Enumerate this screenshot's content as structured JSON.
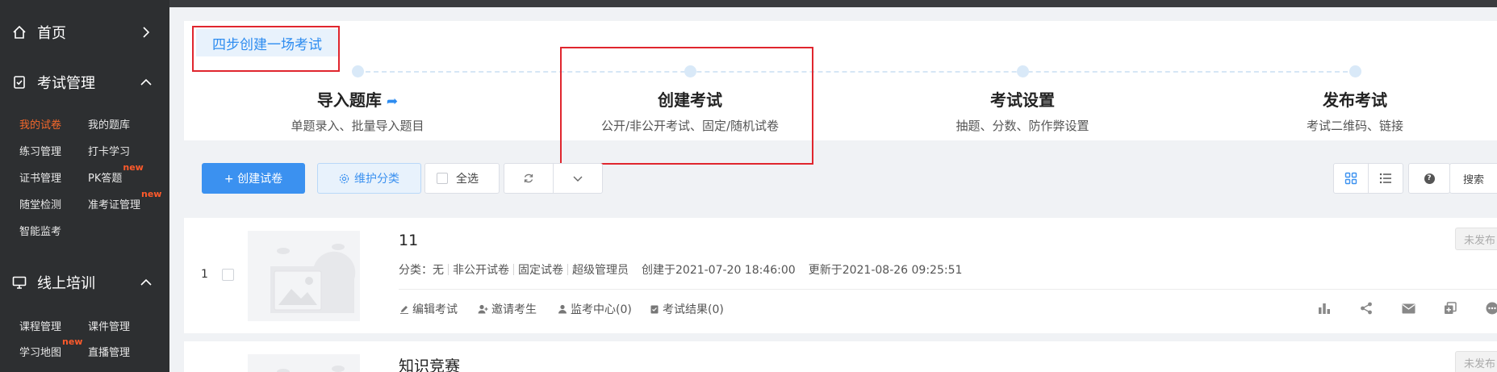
{
  "sidebar": {
    "sections": [
      {
        "label": "首页",
        "icon": "home-icon"
      },
      {
        "label": "考试管理",
        "icon": "exam-icon"
      },
      {
        "label": "线上培训",
        "icon": "monitor-icon"
      }
    ],
    "exam_items": [
      {
        "label": "我的试卷",
        "active": true
      },
      {
        "label": "我的题库"
      },
      {
        "label": "练习管理"
      },
      {
        "label": "打卡学习"
      },
      {
        "label": "证书管理"
      },
      {
        "label": "PK答题",
        "badge": "new"
      },
      {
        "label": "随堂检测"
      },
      {
        "label": "准考证管理",
        "badge": "new"
      },
      {
        "label": "智能监考"
      }
    ],
    "training_items": [
      {
        "label": "课程管理"
      },
      {
        "label": "课件管理"
      },
      {
        "label": "学习地图",
        "badge": "new"
      },
      {
        "label": "直播管理"
      }
    ]
  },
  "steps": {
    "tag": "四步创建一场考试",
    "items": [
      {
        "title": "导入题库",
        "desc": "单题录入、批量导入题目"
      },
      {
        "title": "创建考试",
        "desc": "公开/非公开考试、固定/随机试卷"
      },
      {
        "title": "考试设置",
        "desc": "抽题、分数、防作弊设置"
      },
      {
        "title": "发布考试",
        "desc": "考试二维码、链接"
      }
    ]
  },
  "toolbar": {
    "create_label": "+ 创建试卷",
    "category_label": "维护分类",
    "select_all_label": "全选",
    "search_label": "搜索"
  },
  "exams": [
    {
      "index": "1",
      "title": "11",
      "category": "分类：无",
      "visibility": "非公开试卷",
      "paper_type": "固定试卷",
      "owner": "超级管理员",
      "created": "创建于2021-07-20 18:46:00",
      "updated": "更新于2021-08-26 09:25:51",
      "status": "未发布",
      "actions": {
        "edit": "编辑考试",
        "invite": "邀请考生",
        "monitor": "监考中心(0)",
        "results": "考试结果(0)"
      }
    },
    {
      "title": "知识竞赛",
      "status": "未发布"
    }
  ],
  "colors": {
    "sidebar_bg": "#2d2f31",
    "accent": "#3b91f0",
    "active_item": "#f5682b",
    "highlight_border": "#e0262e"
  }
}
